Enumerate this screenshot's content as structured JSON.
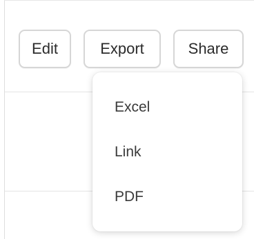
{
  "toolbar": {
    "edit_label": "Edit",
    "export_label": "Export",
    "share_label": "Share"
  },
  "export_menu": {
    "items": [
      {
        "label": "Excel"
      },
      {
        "label": "Link"
      },
      {
        "label": "PDF"
      }
    ]
  },
  "colors": {
    "button_border": "#d6d6d6",
    "text": "#2b2b2b",
    "menu_text": "#3a3a3a",
    "divider": "#e3e3e3",
    "background": "#ffffff"
  }
}
